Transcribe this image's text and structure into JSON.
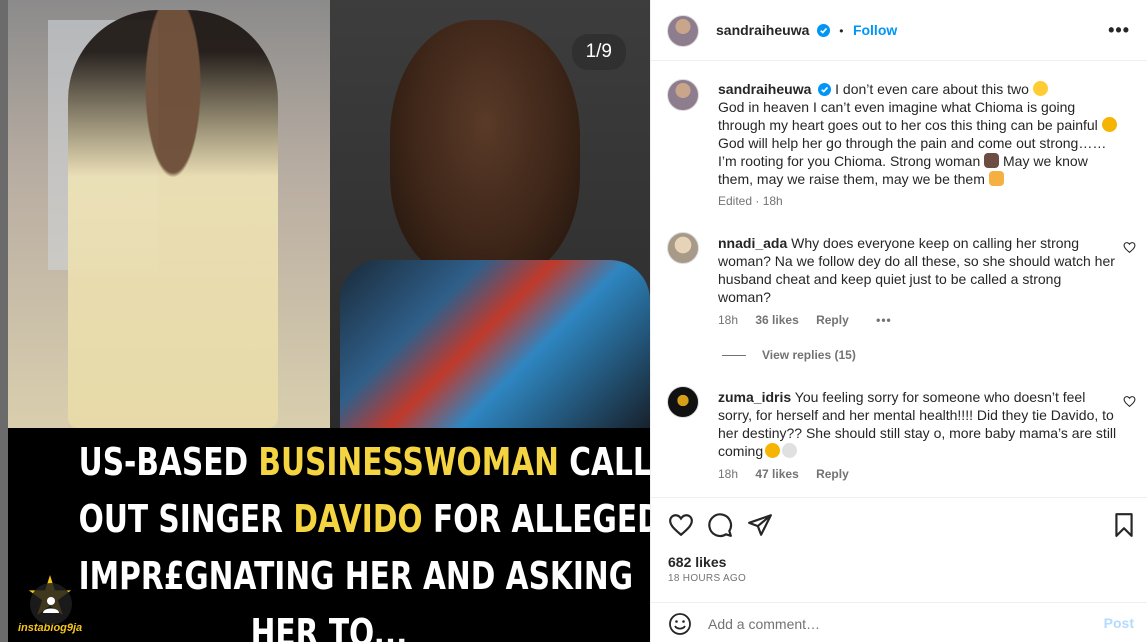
{
  "media": {
    "counter": "1/9",
    "headline": {
      "line1a": "US-BASED ",
      "line1b": "BUSINESSWOMAN",
      "line1c": " CALLS",
      "line2a": "OUT SINGER ",
      "line2b": "DAVIDO",
      "line2c": " FOR ALLEGEDLY",
      "line3": "IMPR£GNATING HER AND ASKING",
      "line4": "HER TO..."
    },
    "brand": "instablog9ja"
  },
  "header": {
    "username": "sandraiheuwa",
    "separator": "•",
    "follow": "Follow",
    "more": "•••"
  },
  "caption": {
    "username": "sandraiheuwa",
    "text_1": " I don’t even care about this two ",
    "text_2": "God in heaven I can’t even imagine what Chioma is going through my heart goes out to her cos this thing can be painful ",
    "text_3": " God will help her go through the pain and come out strong……I’m rooting for you Chioma. Strong woman ",
    "text_4": " May we know them, may we raise them, may we be them ",
    "meta": "Edited · 18h"
  },
  "comments": [
    {
      "username": "nnadi_ada",
      "text": " Why does everyone keep on calling her strong woman? Na we follow dey do all these, so she should watch her husband cheat and keep quiet just to be called a strong woman?",
      "time": "18h",
      "likes": "36 likes",
      "reply": "Reply",
      "more": "•••",
      "view_replies": "View replies (15)"
    },
    {
      "username": "zuma_idris",
      "text": " You feeling sorry for someone who doesn’t feel sorry, for herself and her mental health!!!! Did they tie Davido, to her destiny?? She should still stay o, more baby mama’s are still coming",
      "time": "18h",
      "likes": "47 likes",
      "reply": "Reply"
    }
  ],
  "actions": {
    "likes": "682 likes",
    "ago": "18 HOURS AGO"
  },
  "add_comment": {
    "placeholder": "Add a comment…",
    "post": "Post"
  },
  "colors": {
    "accent": "#0095f6",
    "headline_highlight": "#f5d442",
    "muted": "#737373"
  }
}
